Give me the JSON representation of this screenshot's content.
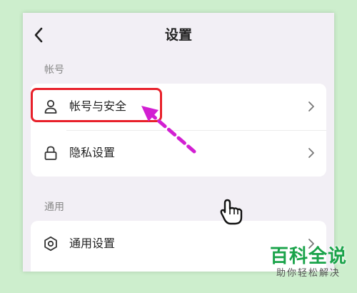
{
  "header": {
    "title": "设置",
    "back_icon": "chevron-left-icon"
  },
  "sections": [
    {
      "label": "帐号",
      "items": [
        {
          "label": "帐号与安全",
          "icon": "person-icon",
          "highlighted": true
        },
        {
          "label": "隐私设置",
          "icon": "lock-icon"
        }
      ]
    },
    {
      "label": "通用",
      "items": [
        {
          "label": "通用设置",
          "icon": "gear-icon"
        }
      ]
    }
  ],
  "annotation": {
    "highlight_color": "#e8202a",
    "arrow_color": "#d21fd2"
  },
  "watermark": {
    "title": "百科全说",
    "subtitle": "助你轻松解决",
    "color": "#1aa34a"
  }
}
